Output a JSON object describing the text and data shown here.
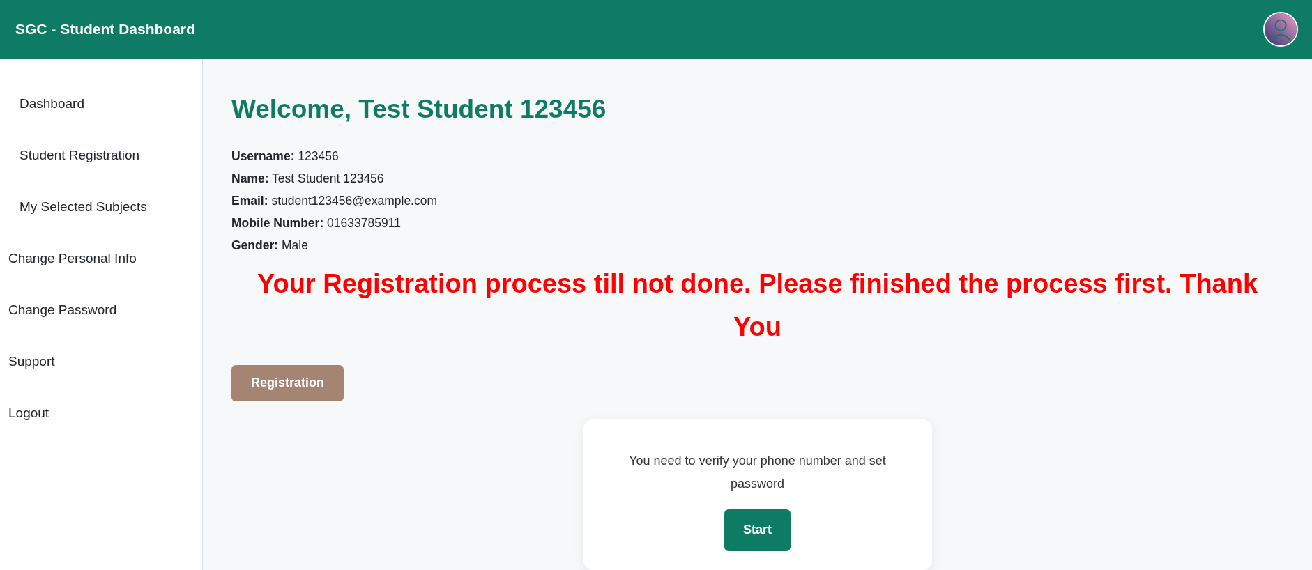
{
  "header": {
    "title": "SGC - Student Dashboard"
  },
  "sidebar": {
    "items": [
      {
        "label": "Dashboard",
        "kind": "sub"
      },
      {
        "label": "Student Registration",
        "kind": "sub"
      },
      {
        "label": "My Selected Subjects",
        "kind": "sub"
      },
      {
        "label": "Change Personal Info",
        "kind": "main"
      },
      {
        "label": "Change Password",
        "kind": "main"
      },
      {
        "label": "Support",
        "kind": "main"
      },
      {
        "label": "Logout",
        "kind": "main"
      }
    ]
  },
  "main": {
    "heading": "Welcome, Test Student 123456",
    "details": [
      {
        "label": "Username:",
        "value": "123456"
      },
      {
        "label": "Name:",
        "value": "Test Student 123456"
      },
      {
        "label": "Email:",
        "value": "student123456@example.com"
      },
      {
        "label": "Mobile Number:",
        "value": "01633785911"
      },
      {
        "label": "Gender:",
        "value": "Male"
      }
    ],
    "alert": "Your Registration process till not done. Please finished the process first. Thank You",
    "registration_button": "Registration",
    "verify_card": {
      "message": "You need to verify your phone number and set password",
      "button": "Start"
    }
  }
}
